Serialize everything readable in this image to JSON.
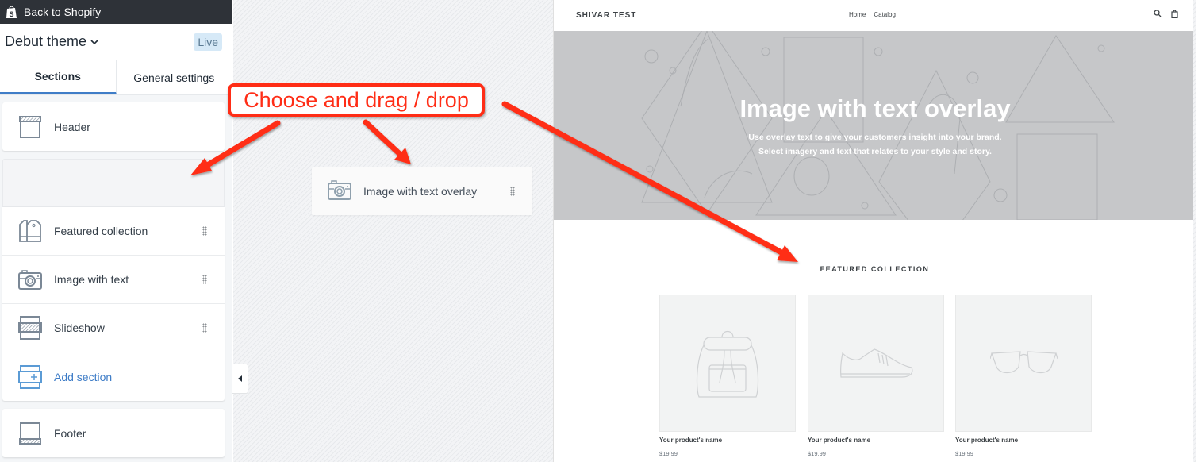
{
  "topbar": {
    "back_label": "Back to Shopify",
    "icon": "shopify-bag-icon"
  },
  "theme": {
    "name": "Debut theme",
    "status_badge": "Live"
  },
  "tabs": [
    {
      "label": "Sections",
      "active": true
    },
    {
      "label": "General settings",
      "active": false
    }
  ],
  "sections": {
    "header": {
      "label": "Header",
      "icon": "header-layout-icon"
    },
    "items": [
      {
        "label": "Featured collection",
        "icon": "collection-tags-icon"
      },
      {
        "label": "Image with text",
        "icon": "camera-icon"
      },
      {
        "label": "Slideshow",
        "icon": "slideshow-layout-icon"
      }
    ],
    "add_section": {
      "label": "Add section",
      "icon": "add-section-icon"
    },
    "footer": {
      "label": "Footer",
      "icon": "footer-layout-icon"
    }
  },
  "dragging_item": {
    "label": "Image with text overlay",
    "icon": "camera-icon"
  },
  "annotation": {
    "callout_text": "Choose and drag / drop",
    "color": "#ff2d16"
  },
  "preview": {
    "store_name": "SHIVAR TEST",
    "nav": [
      "Home",
      "Catalog"
    ],
    "hero": {
      "title": "Image with text overlay",
      "subtitle_line1": "Use overlay text to give your customers insight into your brand.",
      "subtitle_line2": "Select imagery and text that relates to your style and story."
    },
    "featured_title": "FEATURED COLLECTION",
    "products": [
      {
        "name": "Your product's name",
        "price": "$19.99",
        "image": "backpack-placeholder"
      },
      {
        "name": "Your product's name",
        "price": "$19.99",
        "image": "sneaker-placeholder"
      },
      {
        "name": "Your product's name",
        "price": "$19.99",
        "image": "glasses-placeholder"
      }
    ]
  },
  "colors": {
    "accent_blue": "#3f7dc7",
    "topbar": "#2e3238",
    "live_badge_bg": "#d6e9f7"
  }
}
